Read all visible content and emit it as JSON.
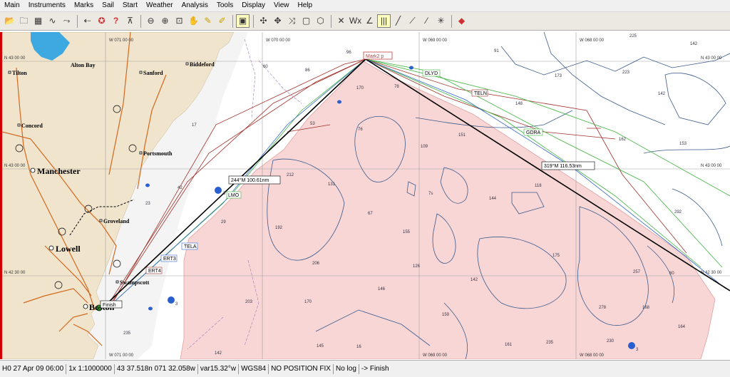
{
  "menu": {
    "items": [
      "Main",
      "Instruments",
      "Marks",
      "Sail",
      "Start",
      "Weather",
      "Analysis",
      "Tools",
      "Display",
      "View",
      "Help"
    ]
  },
  "toolbar": {
    "buttons": [
      {
        "name": "open-folder-icon",
        "glyph": "📂"
      },
      {
        "name": "folder-icon",
        "glyph": "🗀"
      },
      {
        "name": "calendar-icon",
        "glyph": "▦"
      },
      {
        "name": "route-icon",
        "glyph": "∿"
      },
      {
        "name": "route-edit-icon",
        "glyph": "⤳"
      },
      {
        "name": "undo-arrow-icon",
        "glyph": "⇠"
      },
      {
        "name": "life-ring-icon",
        "glyph": "✪"
      },
      {
        "name": "question-icon",
        "glyph": "?"
      },
      {
        "name": "compass-icon",
        "glyph": "⊼"
      },
      {
        "name": "zoom-out-icon",
        "glyph": "⊖"
      },
      {
        "name": "zoom-in-icon",
        "glyph": "⊕"
      },
      {
        "name": "zoom-box-icon",
        "glyph": "⊡"
      },
      {
        "name": "pan-hand-icon",
        "glyph": "✋"
      },
      {
        "name": "pencil-icon",
        "glyph": "✎"
      },
      {
        "name": "highlighter-icon",
        "glyph": "✐"
      },
      {
        "name": "note-icon",
        "glyph": "▣"
      },
      {
        "name": "waypoint-tool-icon",
        "glyph": "✣"
      },
      {
        "name": "mark-tool-icon",
        "glyph": "✥"
      },
      {
        "name": "track-tool-icon",
        "glyph": "⤨"
      },
      {
        "name": "square-tool-icon",
        "glyph": "▢"
      },
      {
        "name": "polygon-tool-icon",
        "glyph": "⬡"
      },
      {
        "name": "cross-tool-icon",
        "glyph": "✕"
      },
      {
        "name": "wind-tool-icon",
        "glyph": "Wx"
      },
      {
        "name": "angle-tool-icon",
        "glyph": "∠"
      },
      {
        "name": "bars-tool-icon",
        "glyph": "|||"
      },
      {
        "name": "line-tool-icon",
        "glyph": "╱"
      },
      {
        "name": "polyline-tool-icon",
        "glyph": "⟋"
      },
      {
        "name": "slash-tool-icon",
        "glyph": "⁄"
      },
      {
        "name": "star-tool-icon",
        "glyph": "✳"
      },
      {
        "name": "diamond-stop-icon",
        "glyph": "◆"
      }
    ]
  },
  "chart": {
    "grid": {
      "lon_labels": [
        "W 071 00 00",
        "W 070 00 00",
        "W 069 00 00",
        "W 068 00 00"
      ],
      "lat_labels": [
        "N 43 00 00",
        "N 43 00 00",
        "N 42 30 00",
        "N 42 30 00"
      ]
    },
    "towns": {
      "tilton": "Tilton",
      "alton_bay": "Alton Bay",
      "sanford": "Sanford",
      "biddeford": "Biddeford",
      "concord": "Concord",
      "portsmouth": "Portsmouth",
      "manchester": "Manchester",
      "groveland": "Groveland",
      "lowell": "Lowell",
      "swampscott": "Swampscott",
      "boston": "Boston"
    },
    "waypoints": {
      "mark2": "Mark2 p",
      "dlyd": "DLYD",
      "teln": "TELN",
      "gdra": "GDRA",
      "lmo": "LMO",
      "tela": "TELA",
      "ert3": "ERT3",
      "ert4": "ERT4",
      "finish": "Finish"
    },
    "legs": {
      "leg1": "244°M 100.61nm",
      "leg2": "319°M 116.53nm"
    },
    "soundings": [
      "225",
      "142",
      "91",
      "96",
      "86",
      "60",
      "170",
      "78",
      "173",
      "223",
      "148",
      "142",
      "17",
      "53",
      "76",
      "151",
      "109",
      "162",
      "153",
      "212",
      "131",
      "118",
      "144",
      "42",
      "23",
      "29",
      "67",
      "155",
      "7s",
      "192",
      "206",
      "126",
      "142",
      "175",
      "292",
      "80",
      "203",
      "170",
      "146",
      "159",
      "257",
      "168",
      "278",
      "164",
      "161",
      "235",
      "230",
      "145",
      "16",
      "142",
      "235"
    ],
    "buoy_labels": [
      "3",
      "3",
      "3"
    ]
  },
  "status": {
    "segments": [
      "H0 27 Apr 09 06:00",
      "1x 1:1000000",
      "43 37.518n 071 32.058w",
      "var15.32°w",
      "WGS84",
      "NO POSITION FIX",
      "No log",
      "-> Finish"
    ]
  },
  "colors": {
    "land": "#f0e4cc",
    "sea": "#ffffff",
    "shaded_area": "#f9d6d6",
    "contour": "#3a5a8a",
    "route_black": "#000000",
    "route_green": "#3cb33c",
    "route_red": "#a0302a",
    "route_blue": "#3366cc",
    "roads": "#d2691e",
    "frame_red": "#d00000"
  }
}
